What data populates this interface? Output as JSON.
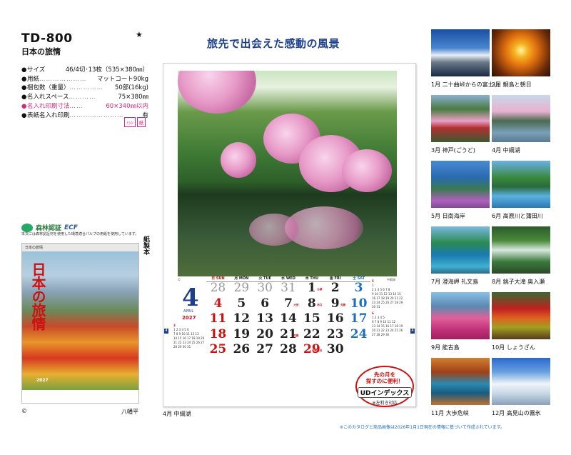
{
  "product": {
    "code": "TD-800",
    "star": "★",
    "name": "日本の旅情"
  },
  "specs": [
    {
      "label": "サイズ",
      "value": "46/4切･13枚（535×380㎜）",
      "dots": "",
      "color": "#111"
    },
    {
      "label": "用紙",
      "value": "マットコート90kg",
      "dots": "…………………",
      "color": "#111"
    },
    {
      "label": "梱包数（重量）",
      "value": "50部(16kg)",
      "dots": "……………",
      "color": "#111"
    },
    {
      "label": "名入れスペース",
      "value": "75×380㎜",
      "dots": "…………",
      "color": "#111"
    },
    {
      "label": "名入れ印刷寸法",
      "value": "60×340㎜以内",
      "dots": "……",
      "color": "#d6277d"
    },
    {
      "label": "表紙名入れ印刷",
      "value": "有",
      "dots": "……………………",
      "color": "#111"
    }
  ],
  "badges": [
    "ﾐｼﾝ",
    "紙"
  ],
  "cert": {
    "label": "森林認証",
    "ecf": "ECF",
    "note": "本文には森林認証材を使用した環境適合パルプの用紙を使用しています。",
    "vertical": "紙製本"
  },
  "cover": {
    "strip": "日本の旅情",
    "title": "日本の旅情",
    "year": "2027",
    "copyright": "©",
    "caption": "八幡平"
  },
  "headline": "旅先で出会えた感動の風景",
  "calendar": {
    "photo_caption_left": "©",
    "photo_caption_right": "中綱湖",
    "month_num": "4",
    "month_en": "APRIL",
    "year": "2027",
    "weekdays": [
      {
        "label": "日 SUN",
        "color": "sun"
      },
      {
        "label": "月 MON",
        "color": "wk"
      },
      {
        "label": "火 TUE",
        "color": "wk"
      },
      {
        "label": "水 WED",
        "color": "wk"
      },
      {
        "label": "木 THU",
        "color": "wk"
      },
      {
        "label": "金 FRI",
        "color": "wk"
      },
      {
        "label": "土 SAT",
        "color": "sat"
      }
    ],
    "days": [
      {
        "n": "28",
        "c": "prev"
      },
      {
        "n": "29",
        "c": "prev"
      },
      {
        "n": "30",
        "c": "prev"
      },
      {
        "n": "31",
        "c": "prev"
      },
      {
        "n": "1",
        "c": "wk",
        "h": "仏滅"
      },
      {
        "n": "2",
        "c": "wk"
      },
      {
        "n": "3",
        "c": "sat"
      },
      {
        "n": "4",
        "c": "sun"
      },
      {
        "n": "5",
        "c": "wk"
      },
      {
        "n": "6",
        "c": "wk"
      },
      {
        "n": "7",
        "c": "wk",
        "h": "大安"
      },
      {
        "n": "8",
        "c": "wk",
        "h": "赤口"
      },
      {
        "n": "9",
        "c": "wk",
        "h": "先勝"
      },
      {
        "n": "10",
        "c": "sat"
      },
      {
        "n": "11",
        "c": "sun"
      },
      {
        "n": "12",
        "c": "wk"
      },
      {
        "n": "13",
        "c": "wk"
      },
      {
        "n": "14",
        "c": "wk"
      },
      {
        "n": "15",
        "c": "wk"
      },
      {
        "n": "16",
        "c": "wk"
      },
      {
        "n": "17",
        "c": "sat"
      },
      {
        "n": "18",
        "c": "sun"
      },
      {
        "n": "19",
        "c": "wk"
      },
      {
        "n": "20",
        "c": "wk"
      },
      {
        "n": "21",
        "c": "wk",
        "h": "先勝"
      },
      {
        "n": "22",
        "c": "wk"
      },
      {
        "n": "23",
        "c": "wk"
      },
      {
        "n": "24",
        "c": "sat"
      },
      {
        "n": "25",
        "c": "sun"
      },
      {
        "n": "26",
        "c": "wk"
      },
      {
        "n": "27",
        "c": "wk"
      },
      {
        "n": "28",
        "c": "wk"
      },
      {
        "n": "29",
        "c": "sun",
        "h": "昭和の日"
      },
      {
        "n": "30",
        "c": "wk"
      },
      {
        "n": "",
        "c": "wk"
      }
    ],
    "mini_prev": {
      "title": "3",
      "rows": [
        "1 2 3 4 5 6",
        "7 8 9 10 11 12 13",
        "14 15 16 17 18 19 20",
        "21 22 23 24 25 26 27",
        "28 29 30 31"
      ]
    },
    "mini_next1": {
      "title": "5",
      "rows": [
        "1",
        "2 3 4 5 6 7 8",
        "9 10 11 12 13 14 15",
        "16 17 18 19 20 21 22",
        "23 24 25 26 27 28 29",
        "30 31"
      ]
    },
    "mini_next2": {
      "title": "6",
      "rows": [
        "1 2 3 4 5",
        "6 7 8 9 10 11 12",
        "13 14 15 16 17 18 19",
        "20 21 22 23 24 25 26",
        "27 28 29 30"
      ]
    },
    "tab_left": "4",
    "tab_right": "4",
    "caption": "4月  中綱湖"
  },
  "ud_index": {
    "line1": "先の月を",
    "line2": "探すのに便利！",
    "badge": "UDインデックス",
    "note": "※左利き対応"
  },
  "months": [
    {
      "caption": "1月  二十曲峠からの富士山",
      "bg": "linear-gradient(180deg,#1a4fa0 0%,#4a86d0 40%,#e8eef5 55%,#6a7a8a 70%,#1a2a40 100%)"
    },
    {
      "caption": "2月  鯛島と朝日",
      "bg": "radial-gradient(circle at 50% 45%,#fff6a0 0,#f5b020 18%,#e07010 40%,#6a2a08 75%,#2a1004 100%)"
    },
    {
      "caption": "3月  神戸(ごうど)",
      "bg": "linear-gradient(180deg,#8ab0d0 0%,#4a7a40 30%,#e8a0c8 55%,#b03030 70%,#3a5a30 100%)"
    },
    {
      "caption": "4月  中綱湖",
      "bg": "linear-gradient(180deg,#c8d8e8 0%,#e8b0d0 35%,#4a6a50 55%,#7aa0b8 80%,#5a7a90 100%)"
    },
    {
      "caption": "5月  日南海岸",
      "bg": "linear-gradient(180deg,#4a8ad0 0%,#2a6ab0 35%,#3a7a50 60%,#b060c0 85%,#804a90 100%)"
    },
    {
      "caption": "6月  高原川と蒲田川",
      "bg": "linear-gradient(180deg,#6ab0e8 0%,#3a8a40 35%,#2a6a3a 55%,#5ab0e0 75%,#2a7ab0 100%)"
    },
    {
      "caption": "7月  澄海岬 礼文島",
      "bg": "linear-gradient(180deg,#7ab8e0 0%,#2a8a50 35%,#1a7ab0 60%,#40b0d0 85%,#2a6a8a 100%)"
    },
    {
      "caption": "8月  銚子大滝 奥入瀬",
      "bg": "linear-gradient(180deg,#2a5a2a 0%,#4a8a3a 30%,#d8e8e0 50%,#3a7a3a 75%,#2a4a2a 100%)"
    },
    {
      "caption": "9月  能古島",
      "bg": "linear-gradient(180deg,#8ac0e8 0%,#5a8ab0 30%,#e0609a 55%,#c03078 80%,#a02060 100%)"
    },
    {
      "caption": "10月  しょうざん",
      "bg": "linear-gradient(180deg,#3a6a30 0%,#c02020 35%,#e06020 55%,#a0a020 75%,#5a3a20 100%)"
    },
    {
      "caption": "11月  大歩危峡",
      "bg": "linear-gradient(180deg,#d08030 0%,#a04018 30%,#2a8ab0 55%,#1a5a80 75%,#c07030 100%)"
    },
    {
      "caption": "12月  高見山の霧氷",
      "bg": "linear-gradient(180deg,#2a6ad0 0%,#6aa0e0 30%,#f0f4f8 55%,#c8d8e8 75%,#8aa0b8 100%)"
    }
  ],
  "footnote": "※このカタログと商品画像は2026年1月1日現在の情報に基づいて作成されています。"
}
